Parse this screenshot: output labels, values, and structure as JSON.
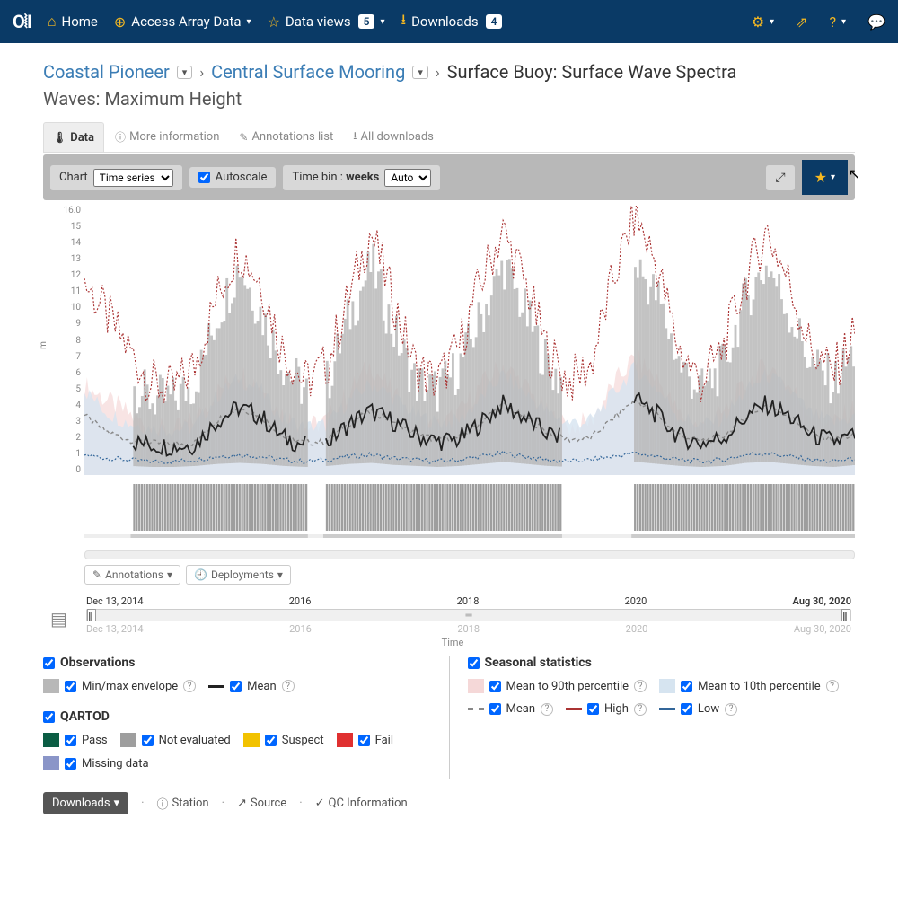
{
  "nav": {
    "home": "Home",
    "array": "Access Array Data",
    "views": "Data views",
    "views_badge": "5",
    "downloads": "Downloads",
    "downloads_badge": "4"
  },
  "breadcrumb": {
    "l1": "Coastal Pioneer",
    "l2": "Central Surface Mooring",
    "l3": "Surface Buoy: Surface Wave Spectra"
  },
  "subtitle": "Waves: Maximum Height",
  "tabs": {
    "data": "Data",
    "more": "More information",
    "anno": "Annotations list",
    "alldl": "All downloads"
  },
  "toolbar": {
    "chart_label": "Chart",
    "chart_select": "Time series",
    "autoscale": "Autoscale",
    "timebin_pre": "Time bin : ",
    "timebin_bold": "weeks",
    "timebin_select": "Auto"
  },
  "chart_data": {
    "type": "line",
    "ylabel": "m",
    "ylim": [
      0,
      16
    ],
    "y_ticks": [
      0.0,
      1,
      2,
      3,
      4,
      5,
      6,
      7,
      8,
      9,
      10,
      11,
      12,
      13,
      14,
      15,
      "16.0"
    ],
    "x_range": [
      "Dec 13, 2014",
      "Aug 30, 2020"
    ],
    "x_ticks": [
      "Dec 13, 2014",
      "2016",
      "2018",
      "2020",
      "Aug 30, 2020"
    ],
    "xlabel": "Time",
    "series_description": "Weekly-binned wave maximum height (m) with seasonal high/low envelopes. Mean oscillates roughly 1.5–5 m with seasonal peaks in winter; 90th-percentile red-dashed envelope spikes to 12–15 m; 10th-percentile blue-dashed envelope stays near 0.5–1.5 m. Grey min/max envelope spans ~1–11 m. Six deployment segments visible (late 2014 → mid 2020) with short gaps between deployments.",
    "mean_approx": [
      3.5,
      2.5,
      2.0,
      1.8,
      1.7,
      1.8,
      3.2,
      4.0,
      3.5,
      2.2,
      1.8,
      1.9,
      3.0,
      3.8,
      3.2,
      2.4,
      2.0,
      2.1,
      3.1,
      4.2,
      3.4,
      2.5,
      2.0,
      2.1,
      3.3,
      4.5,
      3.6,
      2.3,
      1.9,
      2.2,
      3.4,
      4.2,
      3.5,
      2.4,
      2.0,
      2.3
    ],
    "high_approx": [
      11,
      9,
      7,
      5,
      4.5,
      6,
      10,
      13,
      11,
      7,
      5,
      6,
      10,
      14,
      10,
      6,
      5,
      7,
      11,
      14,
      11,
      7,
      5,
      6,
      11,
      15,
      12,
      7,
      5,
      7,
      11,
      14,
      11,
      7,
      5.5,
      8
    ],
    "low_approx": [
      1.2,
      1.0,
      0.9,
      0.8,
      0.8,
      0.9,
      1.1,
      1.2,
      1.1,
      0.9,
      0.8,
      0.9,
      1.1,
      1.2,
      1.0,
      0.9,
      0.8,
      0.9,
      1.1,
      1.3,
      1.1,
      0.9,
      0.8,
      0.9,
      1.1,
      1.3,
      1.1,
      0.9,
      0.8,
      0.9,
      1.2,
      1.3,
      1.1,
      0.9,
      0.8,
      1.0
    ],
    "envelope_max_approx": [
      8,
      6,
      4,
      3,
      3,
      4,
      8,
      11,
      8,
      5,
      3.5,
      4,
      8,
      11,
      7,
      4,
      3.5,
      5,
      8,
      11,
      8,
      5,
      3.5,
      4.5,
      8,
      11,
      9,
      5,
      3.5,
      5,
      9,
      11,
      8,
      5,
      4,
      6
    ],
    "gaps_approx_frac": [
      [
        0.0,
        0.06
      ],
      [
        0.29,
        0.31
      ],
      [
        0.62,
        0.71
      ]
    ]
  },
  "chart_btns": {
    "anno": "Annotations",
    "deploy": "Deployments"
  },
  "timerange": {
    "start": "Dec 13, 2014",
    "t1": "2016",
    "t2": "2018",
    "t3": "2020",
    "end": "Aug 30, 2020",
    "caption": "Time"
  },
  "legend": {
    "obs": "Observations",
    "minmax": "Min/max envelope",
    "mean": "Mean",
    "seas": "Seasonal statistics",
    "p90": "Mean to 90th percentile",
    "p10": "Mean to 10th percentile",
    "smean": "Mean",
    "high": "High",
    "low": "Low",
    "qartod": "QARTOD",
    "pass": "Pass",
    "noteval": "Not evaluated",
    "suspect": "Suspect",
    "fail": "Fail",
    "missing": "Missing data"
  },
  "colors": {
    "accent": "#0a3a66",
    "gold": "#f5b821",
    "minmax": "#b8b8b8",
    "mean": "#222222",
    "p90": "#f5d8d8",
    "p10": "#d6e4f0",
    "smean": "#888888",
    "high": "#aa3333",
    "low": "#336699",
    "pass": "#0b5d44",
    "noteval": "#9e9e9e",
    "suspect": "#f2c200",
    "fail": "#e03030",
    "missing": "#8a95c8"
  },
  "footer": {
    "downloads": "Downloads",
    "station": "Station",
    "source": "Source",
    "qc": "QC Information"
  }
}
